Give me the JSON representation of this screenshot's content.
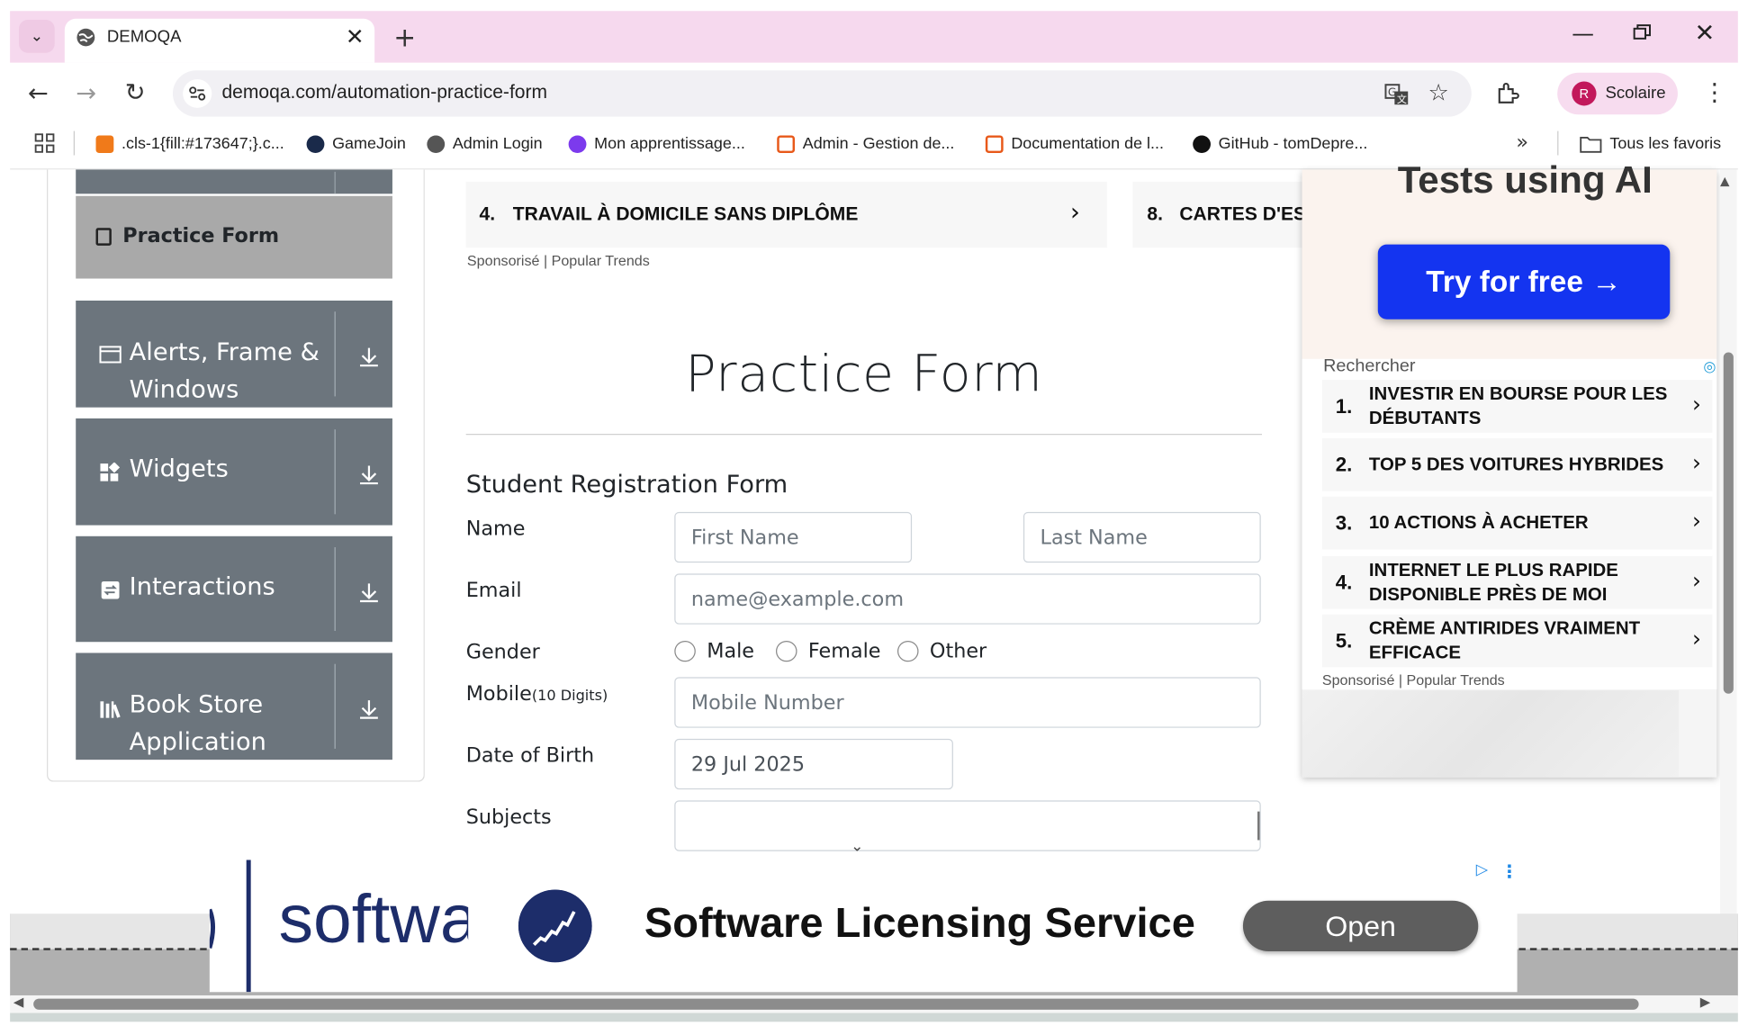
{
  "browser": {
    "tab_title": "DEMOQA",
    "url": "demoqa.com/automation-practice-form",
    "profile_initial": "R",
    "profile_name": "Scolaire",
    "bookmarks": [
      {
        "label": ".cls-1{fill:#173647;}.c...",
        "icon": "orange-logo-icon"
      },
      {
        "label": "GameJoin",
        "icon": "gamejoin-icon"
      },
      {
        "label": "Admin Login",
        "icon": "globe-icon"
      },
      {
        "label": "Mon apprentissage...",
        "icon": "purple-logo-icon"
      },
      {
        "label": "Admin - Gestion de...",
        "icon": "xampp-icon"
      },
      {
        "label": "Documentation de l...",
        "icon": "xampp-icon"
      },
      {
        "label": "GitHub - tomDepre...",
        "icon": "github-icon"
      }
    ],
    "all_bookmarks": "Tous les favoris"
  },
  "sidebar": {
    "practice_form": "Practice Form",
    "groups": [
      {
        "line1": "Alerts, Frame &",
        "line2": "Windows",
        "icon": "window-icon"
      },
      {
        "line1": "Widgets",
        "line2": "",
        "icon": "widgets-icon"
      },
      {
        "line1": "Interactions",
        "line2": "",
        "icon": "interactions-icon"
      },
      {
        "line1": "Book Store",
        "line2": "Application",
        "icon": "bookstore-icon"
      }
    ]
  },
  "top_ads": {
    "item1_num": "4.",
    "item1_text": "TRAVAIL À DOMICILE SANS DIPLÔME",
    "item2_num": "8.",
    "item2_text": "CARTES D'ESSENCE",
    "sponsor": "Sponsorisé | Popular Trends"
  },
  "form": {
    "page_title": "Practice Form",
    "heading": "Student Registration Form",
    "name_label": "Name",
    "first_name_placeholder": "First Name",
    "last_name_placeholder": "Last Name",
    "email_label": "Email",
    "email_placeholder": "name@example.com",
    "gender_label": "Gender",
    "gender_options": [
      "Male",
      "Female",
      "Other"
    ],
    "mobile_label": "Mobile",
    "mobile_hint": "(10 Digits)",
    "mobile_placeholder": "Mobile Number",
    "dob_label": "Date of Birth",
    "dob_value": "29 Jul 2025",
    "subjects_label": "Subjects",
    "subjects_value": ""
  },
  "right_ad": {
    "headline": "Tests using AI",
    "cta": "Try for free →",
    "search_label": "Rechercher",
    "items": [
      {
        "num": "1.",
        "text": "INVESTIR EN BOURSE POUR LES DÉBUTANTS"
      },
      {
        "num": "2.",
        "text": "TOP 5 DES VOITURES HYBRIDES"
      },
      {
        "num": "3.",
        "text": "10 ACTIONS À ACHETER"
      },
      {
        "num": "4.",
        "text": "INTERNET LE PLUS RAPIDE DISPONIBLE PRÈS DE MOI"
      },
      {
        "num": "5.",
        "text": "CRÈME ANTIRIDES VRAIMENT EFFICACE"
      }
    ],
    "sponsor": "Sponsorisé | Popular Trends"
  },
  "bottom_ad": {
    "brand_fragment": "softwa",
    "title": "Software Licensing Service",
    "cta": "Open"
  },
  "colors": {
    "tabbar": "#f6d9ee",
    "sidebar_group": "#6c757d",
    "sidebar_active": "#a9a9a9",
    "ad_button": "#1434f0"
  }
}
